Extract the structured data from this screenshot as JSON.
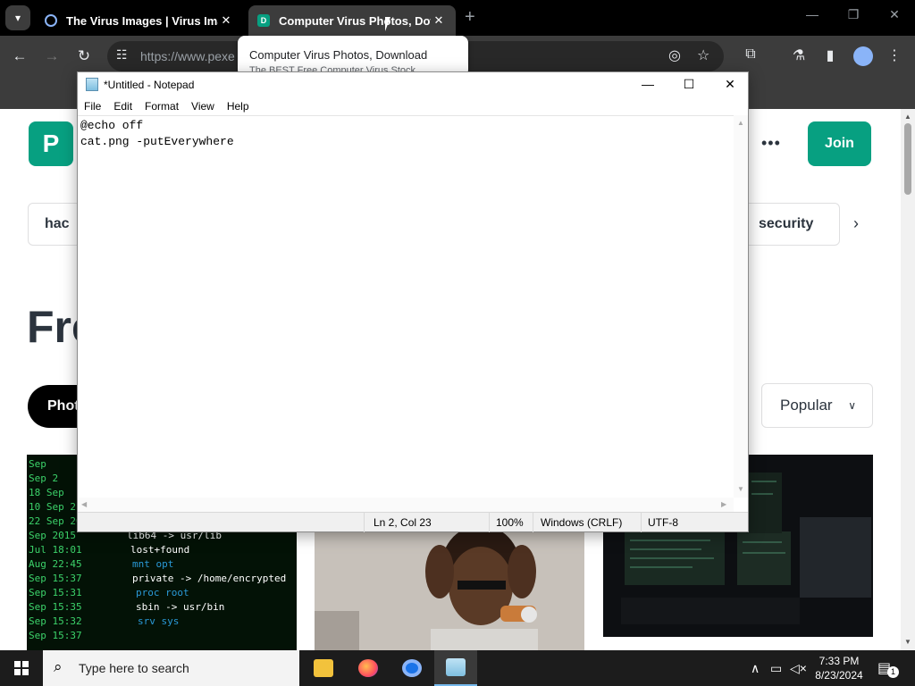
{
  "browser": {
    "tabs": [
      {
        "title": "The Virus Images | Virus Image",
        "active": false
      },
      {
        "title": "Computer Virus Photos, Downl",
        "active": true
      }
    ],
    "tooltip": {
      "title": "Computer Virus Photos, Download",
      "subtitle": "The BEST Free Computer Virus Stock"
    },
    "url": "https://www.pexe"
  },
  "page": {
    "logo": "P",
    "join_label": "Join",
    "chips": [
      "hac",
      "security"
    ],
    "hero_partial": "Fre",
    "media_filter": "Phot",
    "sort": {
      "selected": "Popular"
    }
  },
  "notepad": {
    "title": "*Untitled - Notepad",
    "menu": [
      "File",
      "Edit",
      "Format",
      "View",
      "Help"
    ],
    "content": "@echo off\ncat.png -putEverywhere",
    "status": {
      "position": "Ln 2, Col 23",
      "zoom": "100%",
      "line_ending": "Windows (CRLF)",
      "encoding": "UTF-8"
    }
  },
  "taskbar": {
    "search_placeholder": "Type here to search",
    "time": "7:33 PM",
    "date": "8/23/2024",
    "notification_count": "1"
  },
  "colors": {
    "brand": "#07a081",
    "chrome_dark": "#3c3c3c"
  }
}
